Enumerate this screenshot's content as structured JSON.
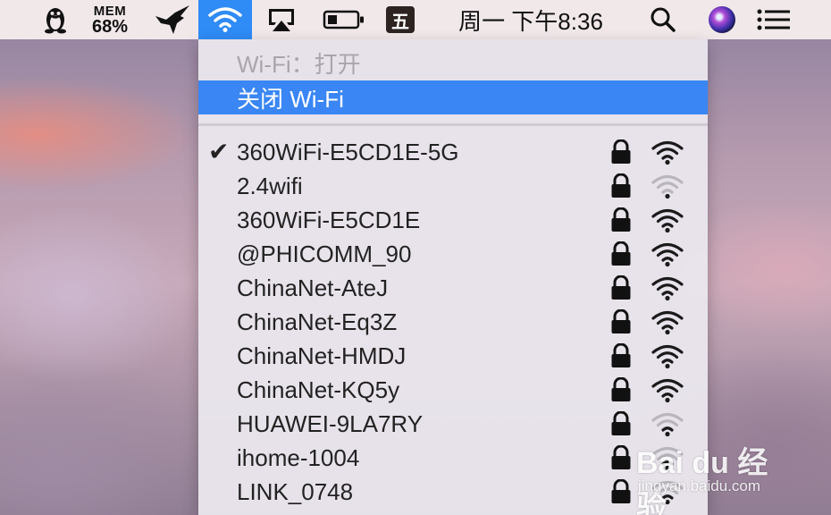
{
  "menubar": {
    "mem_label": "MEM",
    "mem_value": "68%",
    "ime_label": "五",
    "clock": "周一 下午8:36",
    "icons": [
      "qq-penguin-icon",
      "bird-icon",
      "wifi-icon",
      "airplay-icon",
      "battery-icon",
      "input-method-icon",
      "spotlight-search-icon",
      "siri-icon",
      "notification-center-icon"
    ],
    "accent_color": "#2f8bf5"
  },
  "wifi_menu": {
    "status": "Wi-Fi：打开",
    "toggle_label": "关闭 Wi-Fi",
    "highlight_color": "#3a86f4",
    "networks": [
      {
        "name": "360WiFi-E5CD1E-5G",
        "connected": true,
        "check": "✔",
        "secured": true,
        "signal": 4
      },
      {
        "name": "2.4wifi",
        "connected": false,
        "secured": true,
        "signal": 1
      },
      {
        "name": "360WiFi-E5CD1E",
        "connected": false,
        "secured": true,
        "signal": 4
      },
      {
        "name": "@PHICOMM_90",
        "connected": false,
        "secured": true,
        "signal": 4
      },
      {
        "name": "ChinaNet-AteJ",
        "connected": false,
        "secured": true,
        "signal": 4
      },
      {
        "name": "ChinaNet-Eq3Z",
        "connected": false,
        "secured": true,
        "signal": 4
      },
      {
        "name": "ChinaNet-HMDJ",
        "connected": false,
        "secured": true,
        "signal": 4
      },
      {
        "name": "ChinaNet-KQ5y",
        "connected": false,
        "secured": true,
        "signal": 4
      },
      {
        "name": "HUAWEI-9LA7RY",
        "connected": false,
        "secured": true,
        "signal": 2
      },
      {
        "name": "ihome-1004",
        "connected": false,
        "secured": true,
        "signal": 2
      },
      {
        "name": "LINK_0748",
        "connected": false,
        "secured": true,
        "signal": 2
      }
    ]
  },
  "watermark": {
    "brand": "Bai du 经验",
    "site": "jingyan.baidu.com"
  }
}
